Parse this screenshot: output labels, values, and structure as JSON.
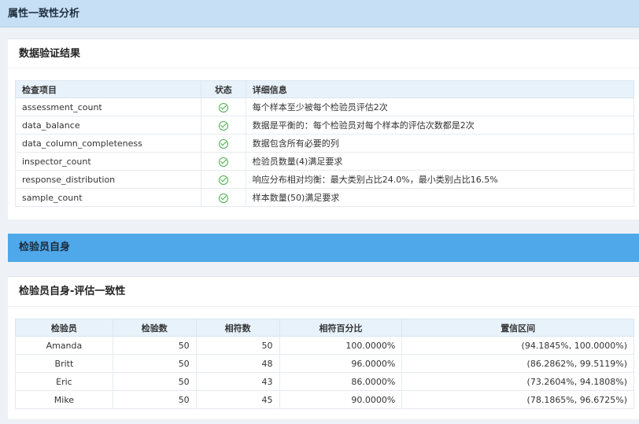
{
  "header": {
    "title": "属性一致性分析"
  },
  "validation": {
    "title": "数据验证结果",
    "columns": [
      "检查项目",
      "状态",
      "详细信息"
    ],
    "rows": [
      {
        "item": "assessment_count",
        "detail": "每个样本至少被每个检验员评估2次"
      },
      {
        "item": "data_balance",
        "detail": "数据是平衡的：每个检验员对每个样本的评估次数都是2次"
      },
      {
        "item": "data_column_completeness",
        "detail": "数据包含所有必要的列"
      },
      {
        "item": "inspector_count",
        "detail": "检验员数量(4)满足要求"
      },
      {
        "item": "response_distribution",
        "detail": "响应分布相对均衡：最大类别占比24.0%，最小类别占比16.5%"
      },
      {
        "item": "sample_count",
        "detail": "样本数量(50)满足要求"
      }
    ],
    "status_icon": "check-circle-icon",
    "status_color": "#4cae4c"
  },
  "section": {
    "title": "检验员自身"
  },
  "within": {
    "title": "检验员自身-评估一致性",
    "columns": [
      "检验员",
      "检验数",
      "相符数",
      "相符百分比",
      "置信区间"
    ],
    "rows": [
      {
        "inspector": "Amanda",
        "count": "50",
        "match": "50",
        "pct": "100.0000%",
        "ci": "(94.1845%, 100.0000%)"
      },
      {
        "inspector": "Britt",
        "count": "50",
        "match": "48",
        "pct": "96.0000%",
        "ci": "(86.2862%, 99.5119%)"
      },
      {
        "inspector": "Eric",
        "count": "50",
        "match": "43",
        "pct": "86.0000%",
        "ci": "(73.2604%, 94.1808%)"
      },
      {
        "inspector": "Mike",
        "count": "50",
        "match": "45",
        "pct": "90.0000%",
        "ci": "(78.1865%, 96.6725%)"
      }
    ]
  },
  "colors": {
    "header_bg": "#c6dff5",
    "section_bg": "#4fa8ea",
    "table_head_bg": "#e8f2fb",
    "page_bg": "#eef2f6"
  }
}
